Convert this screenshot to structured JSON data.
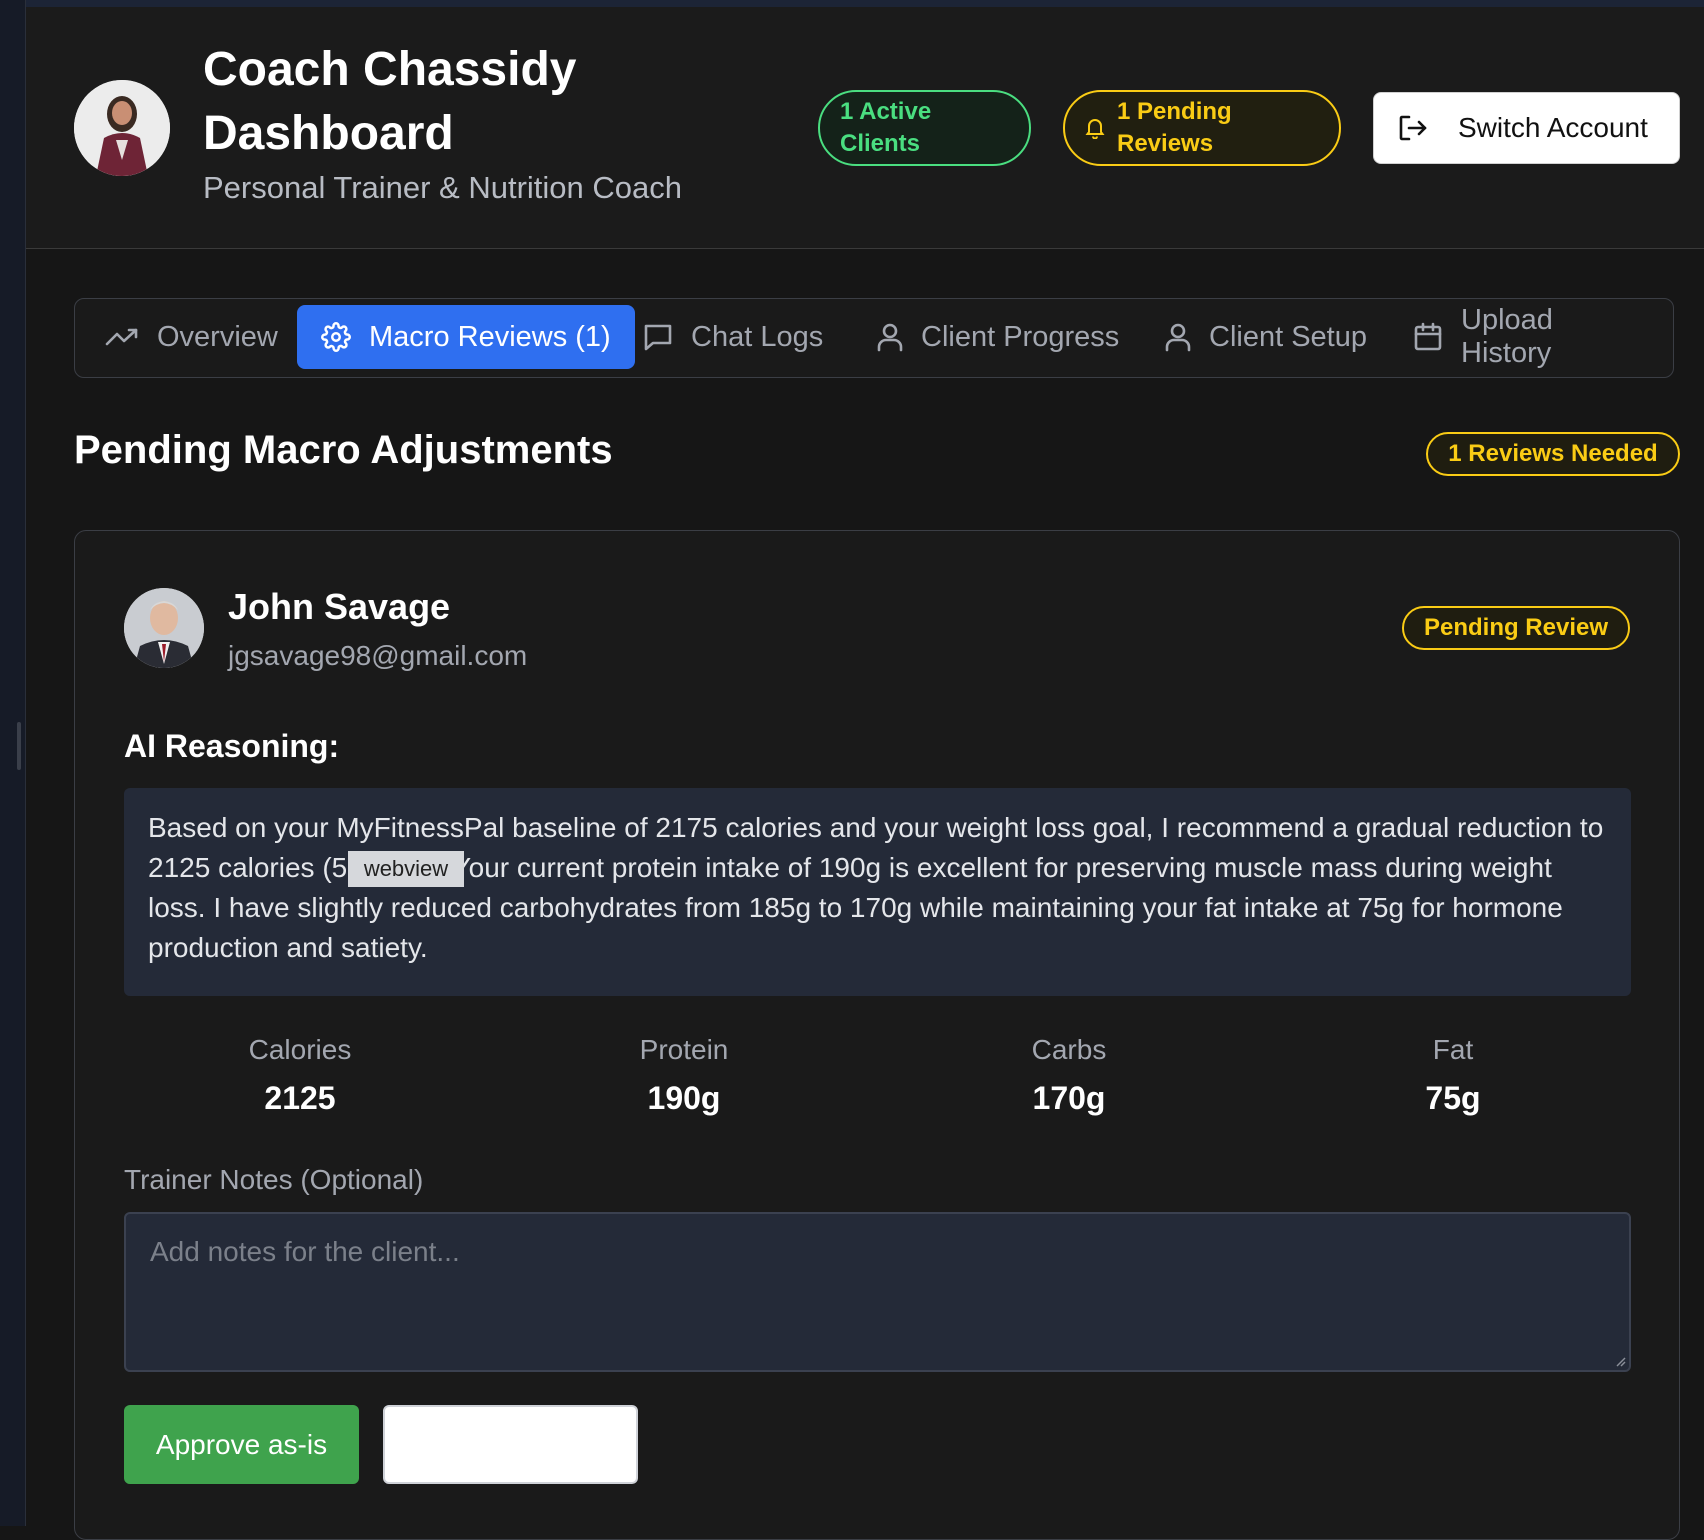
{
  "header": {
    "title": "Coach Chassidy Dashboard",
    "subtitle": "Personal Trainer & Nutrition Coach",
    "active_clients": "1 Active Clients",
    "pending_reviews": "1 Pending Reviews",
    "switch_account": "Switch Account"
  },
  "tabs": [
    {
      "label": "Overview",
      "icon": "trending-up-icon"
    },
    {
      "label": "Macro Reviews (1)",
      "icon": "gear-icon",
      "active": true
    },
    {
      "label": "Chat Logs",
      "icon": "chat-bubble-icon"
    },
    {
      "label": "Client Progress",
      "icon": "user-icon"
    },
    {
      "label": "Client Setup",
      "icon": "user-icon"
    },
    {
      "label": "Upload History",
      "icon": "calendar-icon"
    }
  ],
  "section": {
    "title": "Pending Macro Adjustments",
    "badge": "1 Reviews Needed"
  },
  "review": {
    "client_name": "John Savage",
    "client_email": "jgsavage98@gmail.com",
    "status": "Pending Review",
    "ai_label": "AI Reasoning:",
    "ai_text": "Based on your MyFitnessPal baseline of 2175 calories and your weight loss goal, I recommend a gradual reduction to 2125 calories (5 deficit). Your current protein intake of 190g is excellent for preserving muscle mass during weight loss. I have slightly reduced carbohydrates from 185g to 170g while maintaining your fat intake at 75g for hormone production and satiety.",
    "webview_tag": "webview",
    "macros": [
      {
        "label": "Calories",
        "value": "2125"
      },
      {
        "label": "Protein",
        "value": "190g"
      },
      {
        "label": "Carbs",
        "value": "170g"
      },
      {
        "label": "Fat",
        "value": "75g"
      }
    ],
    "notes_label": "Trainer Notes (Optional)",
    "notes_placeholder": "Add notes for the client...",
    "notes_value": "",
    "approve_label": "Approve as-is",
    "second_button_label": ""
  },
  "colors": {
    "accent_blue": "#2f6ff0",
    "success_green": "#4ade80",
    "warning_yellow": "#facc15",
    "approve_green": "#3fa34d"
  }
}
